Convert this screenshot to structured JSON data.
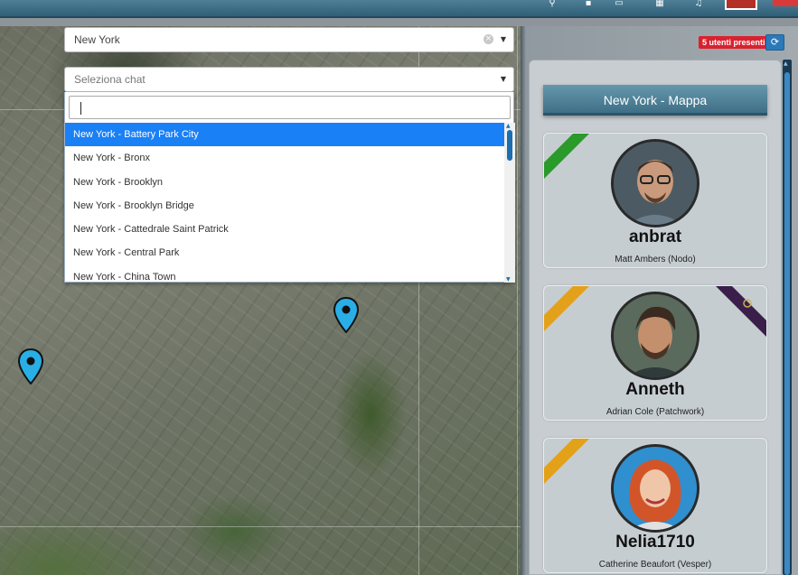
{
  "city_select": {
    "value": "New York"
  },
  "chat_select": {
    "placeholder": "Seleziona chat"
  },
  "chat_options": [
    "New York - Battery Park City",
    "New York - Bronx",
    "New York - Brooklyn",
    "New York - Brooklyn Bridge",
    "New York - Cattedrale Saint Patrick",
    "New York - Central Park",
    "New York - China Town"
  ],
  "active_option_index": 0,
  "users_badge": "5 utenti presenti",
  "room_title": "New York - Mappa",
  "users": [
    {
      "nick": "anbrat",
      "fullname": "Matt Ambers (Nodo)",
      "ribbon_color": "#2a9a2a"
    },
    {
      "nick": "Anneth",
      "fullname": "Adrian Cole (Patchwork)",
      "ribbon_color": "#e3a11a",
      "right_ribbon_color": "#3a1f4a"
    },
    {
      "nick": "Nelia1710",
      "fullname": "Catherine Beaufort (Vesper)",
      "ribbon_color": "#e3a11a"
    }
  ],
  "colors": {
    "accent": "#1a80f5",
    "pin": "#29aee6",
    "badge": "#d9222f"
  }
}
